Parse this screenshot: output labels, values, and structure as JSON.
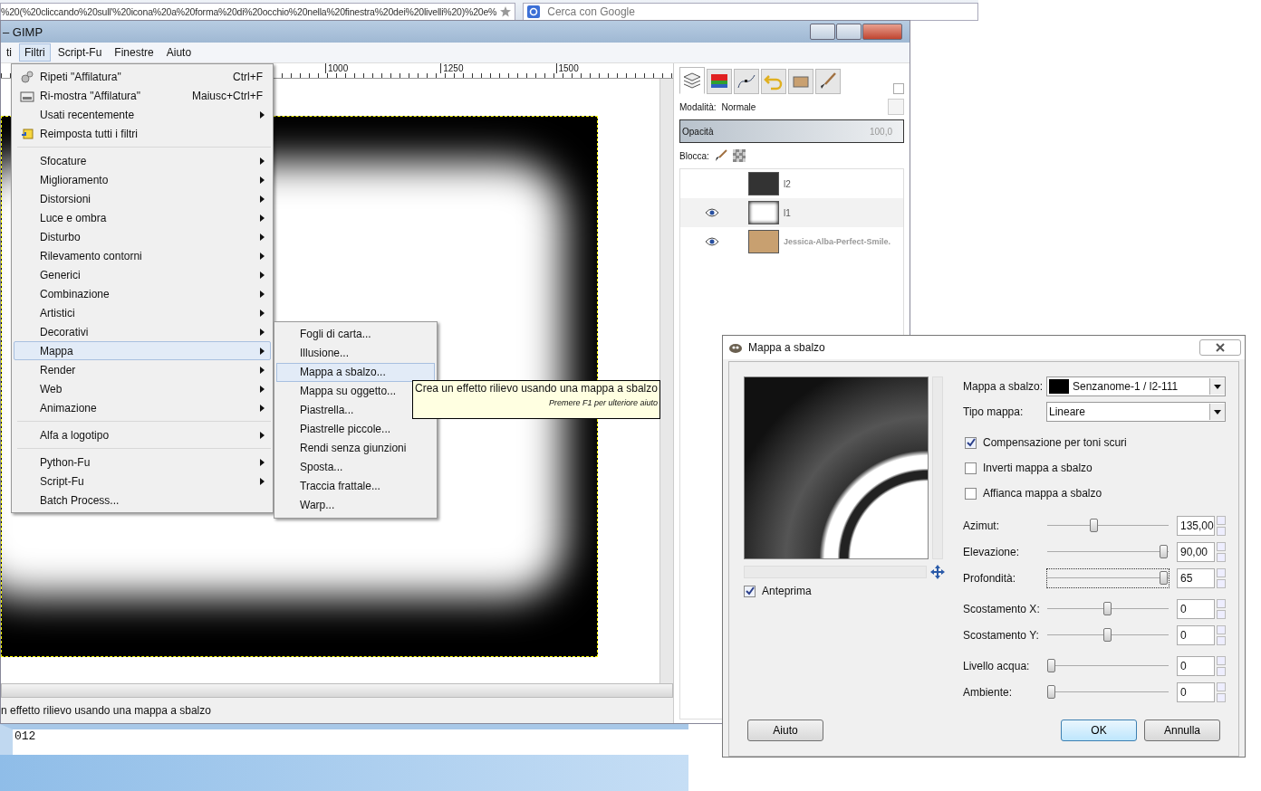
{
  "browser": {
    "url": "%20(%20cliccando%20sull'%20icona%20a%20forma%20di%20occhio%20nella%20finestra%20dei%20livelli%20)%20e%",
    "search_placeholder": "Cerca con Google"
  },
  "gimp": {
    "title": "– GIMP",
    "menubar": [
      {
        "label": "ti",
        "selected": false
      },
      {
        "label": "Filtri",
        "selected": true
      },
      {
        "label": "Script-Fu",
        "selected": false
      },
      {
        "label": "Finestre",
        "selected": false
      },
      {
        "label": "Aiuto",
        "selected": false
      }
    ],
    "ruler_labels": [
      "1000",
      "1250",
      "1500"
    ],
    "status": "n effetto rilievo usando una mappa a sbalzo"
  },
  "filters_menu": [
    {
      "kind": "item",
      "label": "Ripeti \"Affilatura\"",
      "shortcut": "Ctrl+F",
      "submenu": false,
      "selected": false
    },
    {
      "kind": "item",
      "label": "Ri-mostra \"Affilatura\"",
      "shortcut": "Maiusc+Ctrl+F",
      "submenu": false,
      "selected": false
    },
    {
      "kind": "item",
      "label": "Usati recentemente",
      "submenu": true,
      "selected": false
    },
    {
      "kind": "item",
      "label": "Reimposta tutti i filtri",
      "submenu": false,
      "selected": false
    },
    {
      "kind": "separator"
    },
    {
      "kind": "item",
      "label": "Sfocature",
      "submenu": true,
      "selected": false
    },
    {
      "kind": "item",
      "label": "Miglioramento",
      "submenu": true,
      "selected": false
    },
    {
      "kind": "item",
      "label": "Distorsioni",
      "submenu": true,
      "selected": false
    },
    {
      "kind": "item",
      "label": "Luce e ombra",
      "submenu": true,
      "selected": false
    },
    {
      "kind": "item",
      "label": "Disturbo",
      "submenu": true,
      "selected": false
    },
    {
      "kind": "item",
      "label": "Rilevamento contorni",
      "submenu": true,
      "selected": false
    },
    {
      "kind": "item",
      "label": "Generici",
      "submenu": true,
      "selected": false
    },
    {
      "kind": "item",
      "label": "Combinazione",
      "submenu": true,
      "selected": false
    },
    {
      "kind": "item",
      "label": "Artistici",
      "submenu": true,
      "selected": false
    },
    {
      "kind": "item",
      "label": "Decorativi",
      "submenu": true,
      "selected": false
    },
    {
      "kind": "item",
      "label": "Mappa",
      "submenu": true,
      "selected": true
    },
    {
      "kind": "item",
      "label": "Render",
      "submenu": true,
      "selected": false
    },
    {
      "kind": "item",
      "label": "Web",
      "submenu": true,
      "selected": false
    },
    {
      "kind": "item",
      "label": "Animazione",
      "submenu": true,
      "selected": false
    },
    {
      "kind": "separator"
    },
    {
      "kind": "item",
      "label": "Alfa a logotipo",
      "submenu": true,
      "selected": false
    },
    {
      "kind": "separator"
    },
    {
      "kind": "item",
      "label": "Python-Fu",
      "submenu": true,
      "selected": false
    },
    {
      "kind": "item",
      "label": "Script-Fu",
      "submenu": true,
      "selected": false
    },
    {
      "kind": "item",
      "label": "Batch Process...",
      "submenu": false,
      "selected": false
    }
  ],
  "map_submenu": [
    {
      "label": "Fogli di carta...",
      "selected": false
    },
    {
      "label": "Illusione...",
      "selected": false
    },
    {
      "label": "Mappa a sbalzo...",
      "selected": true
    },
    {
      "label": "Mappa su oggetto...",
      "selected": false
    },
    {
      "label": "Piastrella...",
      "selected": false
    },
    {
      "label": "Piastrelle piccole...",
      "selected": false
    },
    {
      "label": "Rendi senza giunzioni",
      "selected": false
    },
    {
      "label": "Sposta...",
      "selected": false
    },
    {
      "label": "Traccia frattale...",
      "selected": false
    },
    {
      "label": "Warp...",
      "selected": false
    }
  ],
  "tooltip": {
    "text": "Crea un effetto rilievo usando una mappa a sbalzo",
    "hint": "Premere F1 per ulteriore aiuto"
  },
  "layers_panel": {
    "tabs": [
      {
        "selected": true
      },
      {
        "selected": false
      },
      {
        "selected": false
      },
      {
        "selected": false
      },
      {
        "selected": false
      },
      {
        "selected": false
      }
    ],
    "mode_label": "Modalità:",
    "mode": "Normale",
    "opacity": {
      "label": "Opacità",
      "value": "100,0",
      "level": 1
    },
    "lock_label": "Blocca:",
    "layers": [
      {
        "name": "l2",
        "visible": false,
        "selected": false
      },
      {
        "name": "l1",
        "visible": true,
        "selected": true
      },
      {
        "name": "Jessica-Alba-Perfect-Smile.",
        "visible": true,
        "selected": false
      }
    ]
  },
  "console": {
    "line": "012"
  },
  "dialog": {
    "title": "Mappa a sbalzo",
    "preview_label": "Anteprima",
    "preview_checked": true,
    "map_label": "Mappa a sbalzo:",
    "map_value": "Senzanome-1 / l2-111",
    "type_label": "Tipo mappa:",
    "type_value": "Lineare",
    "checkboxes": [
      {
        "label": "Compensazione per toni scuri",
        "checked": true
      },
      {
        "label": "Inverti mappa a sbalzo",
        "checked": false
      },
      {
        "label": "Affianca mappa a sbalzo",
        "checked": false
      }
    ],
    "slider_groups": [
      [
        {
          "label": "Azimut:",
          "level": 0.375,
          "value": "135,00",
          "focused": false
        },
        {
          "label": "Elevazione:",
          "level": 1,
          "value": "90,00",
          "focused": false
        },
        {
          "label": "Profondità:",
          "level": 1,
          "value": "65",
          "focused": true
        }
      ],
      [
        {
          "label": "Scostamento X:",
          "level": 0.5,
          "value": "0",
          "focused": false
        },
        {
          "label": "Scostamento Y:",
          "level": 0.5,
          "value": "0",
          "focused": false
        }
      ],
      [
        {
          "label": "Livello acqua:",
          "level": 0,
          "value": "0",
          "focused": false
        },
        {
          "label": "Ambiente:",
          "level": 0,
          "value": "0",
          "focused": false
        }
      ]
    ],
    "buttons": [
      {
        "label": "Aiuto",
        "kind": "help",
        "default": false
      },
      {
        "label": "OK",
        "kind": "ok",
        "default": true
      },
      {
        "label": "Annulla",
        "kind": "cancel",
        "default": false
      }
    ]
  }
}
